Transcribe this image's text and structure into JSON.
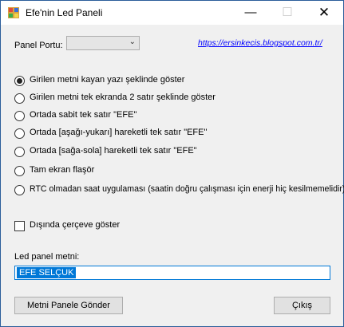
{
  "window": {
    "title": "Efe'nin Led Paneli",
    "controls": {
      "minimize": "—",
      "maximize": "☐",
      "close": "✕"
    }
  },
  "port": {
    "label": "Panel Portu:",
    "value": ""
  },
  "link": {
    "text": "https://ersinkecis.blogspot.com.tr/"
  },
  "options": [
    {
      "label": "Girilen metni kayan yazı şeklinde göster",
      "checked": true
    },
    {
      "label": "Girilen metni tek ekranda 2 satır şeklinde göster",
      "checked": false
    },
    {
      "label": "Ortada sabit tek satır \"EFE\"",
      "checked": false
    },
    {
      "label": "Ortada [aşağı-yukarı] hareketli tek satır \"EFE\"",
      "checked": false
    },
    {
      "label": "Ortada [sağa-sola] hareketli tek satır \"EFE\"",
      "checked": false
    },
    {
      "label": "Tam ekran flaşör",
      "checked": false
    },
    {
      "label": "RTC olmadan saat uygulaması (saatin doğru çalışması için enerji hiç kesilmemelidir)",
      "checked": false
    }
  ],
  "frame_checkbox": {
    "label": "Dışında çerçeve göster",
    "checked": false
  },
  "text_field": {
    "label": "Led panel metni:",
    "value": "EFE SELÇUK"
  },
  "buttons": {
    "send": "Metni Panele Gönder",
    "exit": "Çıkış"
  }
}
